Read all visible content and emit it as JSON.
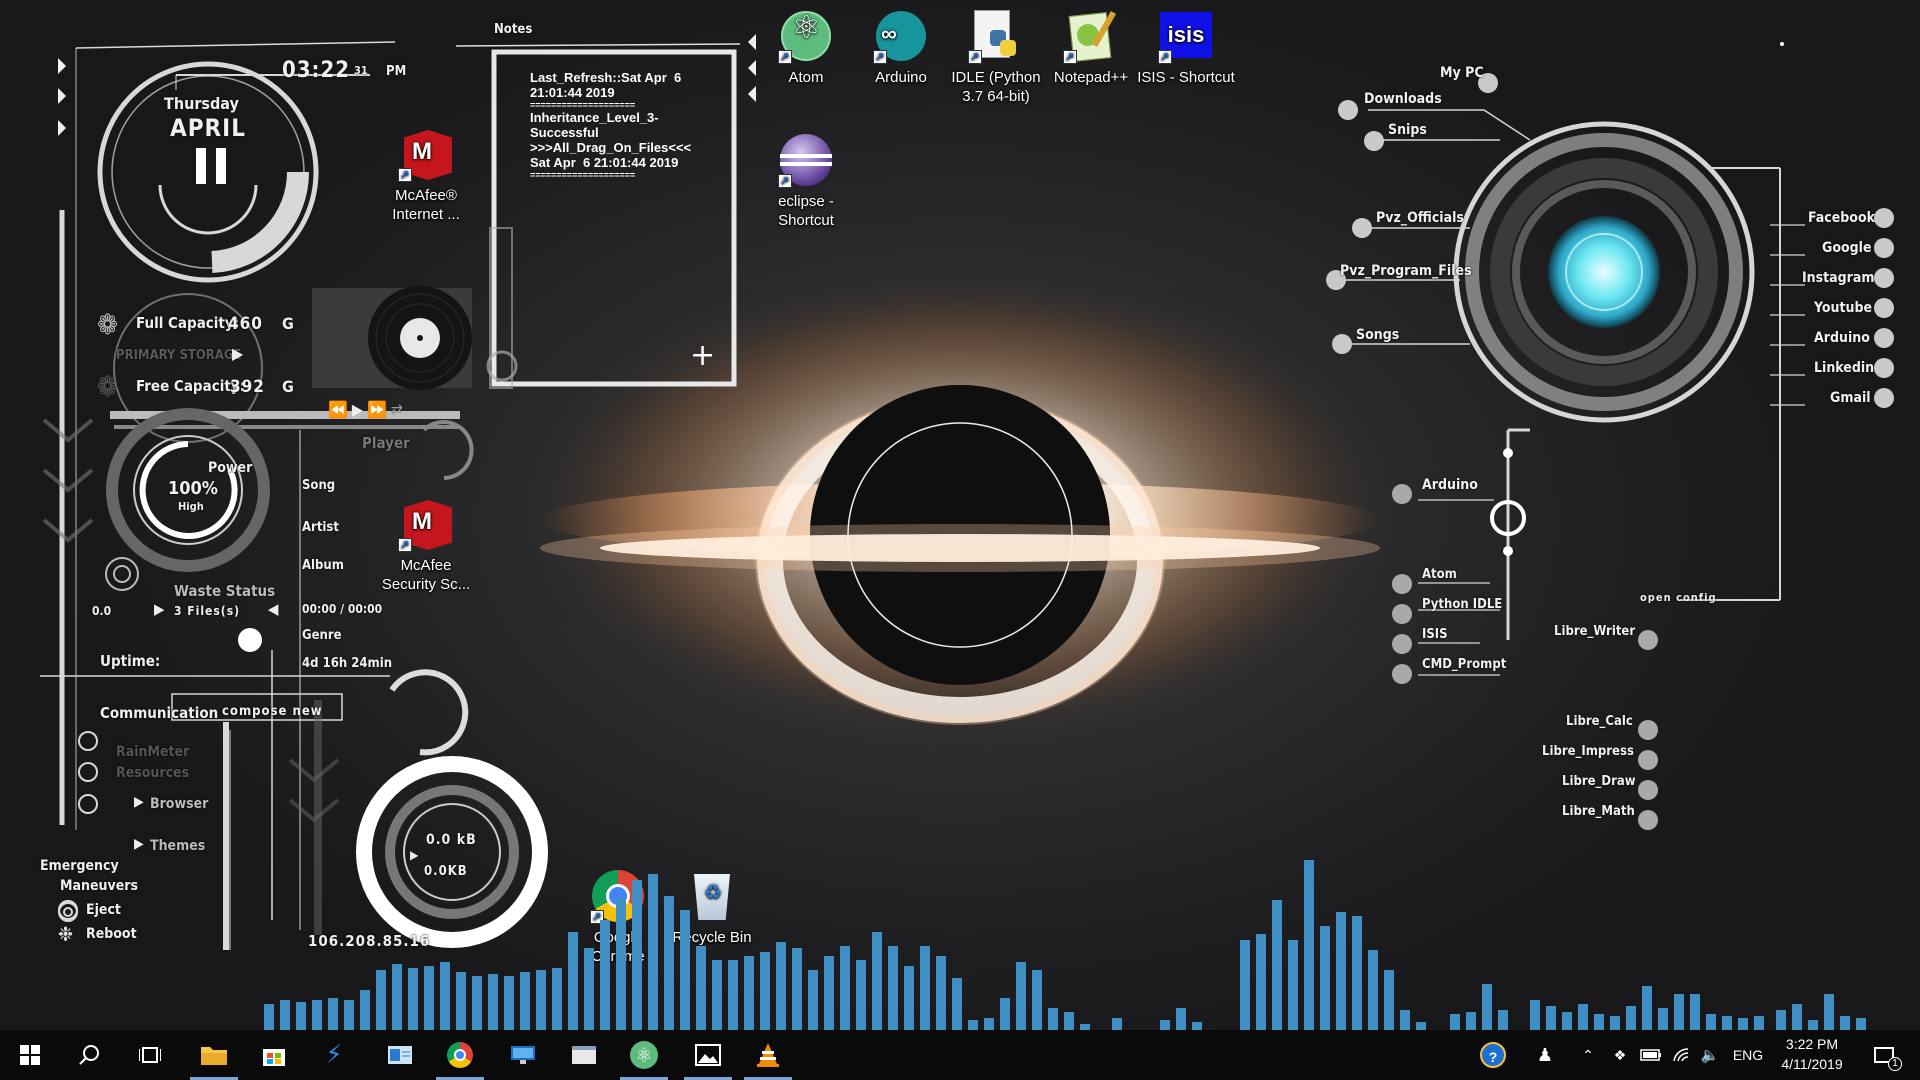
{
  "clock": {
    "time": "03:22",
    "seconds": "31",
    "ampm": "PM",
    "day": "Thursday",
    "month": "April",
    "date": "11"
  },
  "storage": {
    "full_label": "Full Capacity:",
    "full_value": "460",
    "full_unit": "G",
    "primary_label": "PRIMARY STORAGE",
    "free_label": "Free Capacity:",
    "free_value": "392",
    "free_unit": "G"
  },
  "player": {
    "label": "Player",
    "song": "Song",
    "artist": "Artist",
    "album": "Album",
    "time": "00:00 / 00:00",
    "genre": "Genre"
  },
  "power": {
    "label": "Power",
    "percent": "100%",
    "status": "High"
  },
  "waste": {
    "label": "Waste Status",
    "size": "0.0",
    "files": "3 Files(s)"
  },
  "uptime": {
    "label": "Uptime:",
    "value": "4d 16h 24min"
  },
  "communication": {
    "label": "Communication",
    "compose": "compose new"
  },
  "menu": {
    "rainmeter": "RainMeter",
    "resources": "Resources",
    "browser": "Browser",
    "themes": "Themes"
  },
  "emergency": {
    "title_line1": "Emergency",
    "title_line2": "Maneuvers",
    "eject": "Eject",
    "reboot": "Reboot"
  },
  "network": {
    "up": "0.0 kB",
    "down": "0.0KB",
    "ip": "106.208.85.16"
  },
  "notes": {
    "title": "Notes",
    "lines": [
      "Last_Refresh::Sat Apr  6",
      "21:01:44 2019",
      "====================",
      "Inheritance_Level_3-",
      "Successful",
      ">>>All_Drag_On_Files<<<",
      "Sat Apr  6 21:01:44 2019",
      "===================="
    ],
    "add": "+"
  },
  "desktop_icons": [
    {
      "label": "Atom",
      "icon": "atom-icon"
    },
    {
      "label": "Arduino",
      "icon": "arduino-icon"
    },
    {
      "label": "IDLE (Python 3.7 64-bit)",
      "icon": "python-idle-icon"
    },
    {
      "label": "Notepad++",
      "icon": "notepad-plus-plus-icon"
    },
    {
      "label": "ISIS - Shortcut",
      "icon": "isis-icon"
    },
    {
      "label": "eclipse - Shortcut",
      "icon": "eclipse-icon"
    },
    {
      "label": "McAfee® Internet ...",
      "icon": "mcafee-icon"
    },
    {
      "label": "McAfee Security Sc...",
      "icon": "mcafee-icon"
    },
    {
      "label": "Google Chrome",
      "icon": "chrome-icon"
    },
    {
      "label": "Recycle Bin",
      "icon": "recycle-bin-icon"
    }
  ],
  "launcher_left": {
    "mypc": "My PC",
    "downloads": "Downloads",
    "snips": "Snips",
    "pvz_officials": "Pvz_Officials",
    "pvz_program_files": "Pvz_Program_Files",
    "songs": "Songs"
  },
  "launcher_right": [
    "Facebook",
    "Google",
    "Instagram",
    "Youtube",
    "Arduino",
    "Linkedin",
    "Gmail"
  ],
  "apps": {
    "arduino": "Arduino",
    "atom": "Atom",
    "python_idle": "Python IDLE",
    "isis": "ISIS",
    "cmd": "CMD_Prompt",
    "open_config": "open config"
  },
  "libre": [
    "Libre_Writer",
    "Libre_Calc",
    "Libre_Impress",
    "Libre_Draw",
    "Libre_Math"
  ],
  "taskbar": {
    "language": "ENG",
    "time": "3:22 PM",
    "date": "4/11/2019",
    "notifications": "1"
  },
  "colors": {
    "accent": "#4aa3d8",
    "visualizer": "#3f8fc4",
    "arc": "#40e0f0"
  }
}
